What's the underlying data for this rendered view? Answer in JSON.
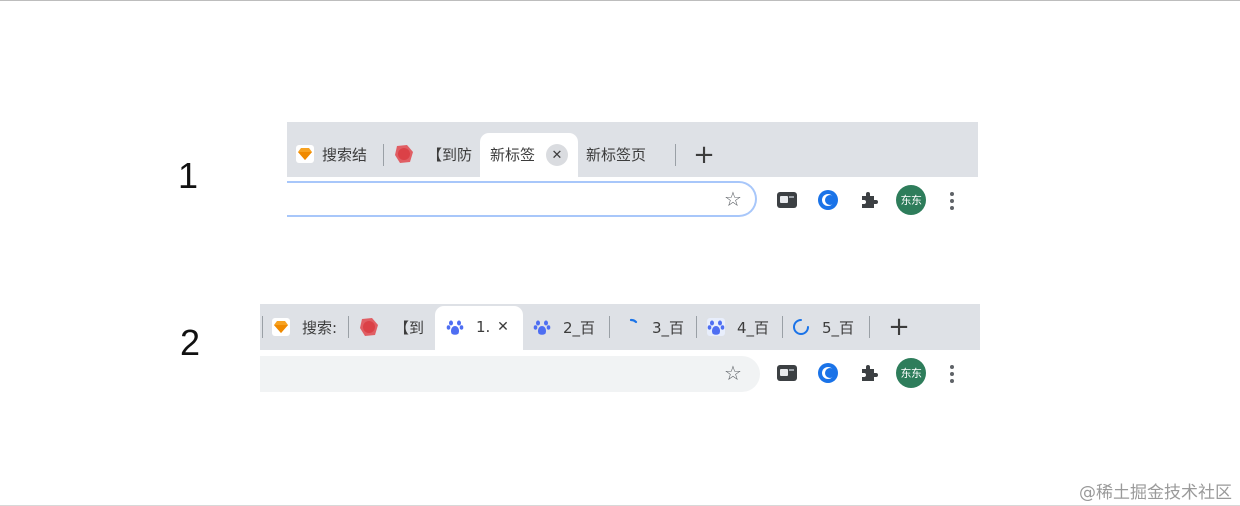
{
  "labels": {
    "one": "1",
    "two": "2"
  },
  "browser1": {
    "tabs": [
      {
        "title": "搜索结",
        "favicon": "sketch-diamond-icon"
      },
      {
        "title": "【到防",
        "favicon": "red-blob-icon"
      },
      {
        "title": "新标签",
        "favicon": "none",
        "active": true,
        "close": "✕"
      },
      {
        "title": "新标签页",
        "favicon": "none"
      }
    ],
    "new_tab": "+",
    "toolbar": {
      "star": "☆",
      "avatar": "东东"
    }
  },
  "browser2": {
    "tabs": [
      {
        "title": "搜索:",
        "favicon": "sketch-diamond-icon"
      },
      {
        "title": "【到",
        "favicon": "red-blob-icon"
      },
      {
        "title": "1.",
        "favicon": "baidu-paw-icon",
        "active": true,
        "close": "✕"
      },
      {
        "title": "2_百",
        "favicon": "baidu-paw-icon"
      },
      {
        "title": "3_百",
        "favicon": "loading-spinner-icon"
      },
      {
        "title": "4_百",
        "favicon": "baidu-paw-icon"
      },
      {
        "title": "5_百",
        "favicon": "loading-spinner-icon"
      }
    ],
    "new_tab": "+",
    "toolbar": {
      "star": "☆",
      "avatar": "东东"
    }
  },
  "watermark": "@稀土掘金技术社区",
  "colors": {
    "tabbar_bg": "#dee1e6",
    "focus_ring": "#a8c7fa",
    "avatar_bg": "#2e7d5b",
    "baidu_blue": "#4e6ef2",
    "spinner_blue": "#1a73e8",
    "sketch_orange": "#f7a221",
    "red_blob": "#e0474c"
  }
}
